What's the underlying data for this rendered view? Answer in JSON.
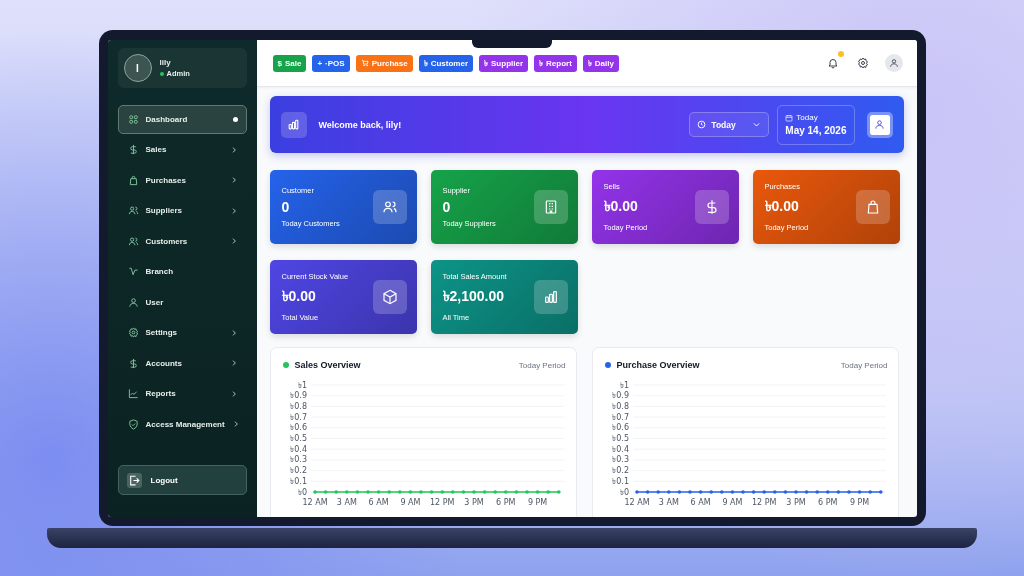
{
  "sidebar": {
    "user": {
      "initial": "I",
      "name": "lily",
      "role": "Admin",
      "online": true
    },
    "items": [
      {
        "label": "Dashboard",
        "selected": true,
        "has_submenu": false
      },
      {
        "label": "Sales",
        "selected": false,
        "has_submenu": true
      },
      {
        "label": "Purchases",
        "selected": false,
        "has_submenu": true
      },
      {
        "label": "Suppliers",
        "selected": false,
        "has_submenu": true
      },
      {
        "label": "Customers",
        "selected": false,
        "has_submenu": true
      },
      {
        "label": "Branch",
        "selected": false,
        "has_submenu": false
      },
      {
        "label": "User",
        "selected": false,
        "has_submenu": false
      },
      {
        "label": "Settings",
        "selected": false,
        "has_submenu": true
      },
      {
        "label": "Accounts",
        "selected": false,
        "has_submenu": true
      },
      {
        "label": "Reports",
        "selected": false,
        "has_submenu": true
      },
      {
        "label": "Access Management",
        "selected": false,
        "has_submenu": true
      }
    ],
    "logout": "Logout"
  },
  "quick_actions": [
    {
      "icon": "$",
      "label": "Sale",
      "color": "#16a34a"
    },
    {
      "icon": "+",
      "label": "·POS",
      "color": "#2563eb"
    },
    {
      "label": "Purchase",
      "color": "#f97316"
    },
    {
      "icon": "৳",
      "label": "Customer",
      "color": "#2563eb"
    },
    {
      "icon": "৳",
      "label": "Supplier",
      "color": "#9333ea"
    },
    {
      "icon": "৳",
      "label": "Report",
      "color": "#9333ea"
    },
    {
      "icon": "৳",
      "label": "Daily",
      "color": "#9333ea"
    }
  ],
  "header": {
    "notifications": true
  },
  "banner": {
    "greeting": "Welcome back, lily!",
    "period": "Today",
    "date_label": "Today",
    "date": "May 14, 2026"
  },
  "stats": [
    {
      "title": "Customer",
      "value": "0",
      "caption": "Today Customers",
      "color": "#2563eb"
    },
    {
      "title": "Supplier",
      "value": "0",
      "caption": "Today Suppliers",
      "color": "#16a34a"
    },
    {
      "title": "Sells",
      "value": "৳0.00",
      "caption": "Today Period",
      "color": "#9333ea"
    },
    {
      "title": "Purchases",
      "value": "৳0.00",
      "caption": "Today Period",
      "color": "#ea580c"
    },
    {
      "title": "Current Stock Value",
      "value": "৳0.00",
      "caption": "Total Value",
      "color": "#4f46e5"
    },
    {
      "title": "Total Sales Amount",
      "value": "৳2,100.00",
      "caption": "All Time",
      "color": "#0d9488"
    }
  ],
  "charts": [
    {
      "title": "Sales Overview",
      "period": "Today Period",
      "chart_data": {
        "type": "line",
        "grid": true,
        "categories": [
          "12 AM",
          null,
          null,
          "3 AM",
          null,
          null,
          "6 AM",
          null,
          null,
          "9 AM",
          null,
          null,
          "12 PM",
          null,
          null,
          "3 PM",
          null,
          null,
          "6 PM",
          null,
          null,
          "9 PM",
          null,
          null
        ],
        "ylim": [
          0,
          1
        ],
        "yticks": [
          {
            "value": 0,
            "label": "৳0"
          },
          {
            "value": 0.1,
            "label": "৳0.1"
          },
          {
            "value": 0.2,
            "label": "৳0.2"
          },
          {
            "value": 0.3,
            "label": "৳0.3"
          },
          {
            "value": 0.4,
            "label": "৳0.4"
          },
          {
            "value": 0.5,
            "label": "৳0.5"
          },
          {
            "value": 0.6,
            "label": "৳0.6"
          },
          {
            "value": 0.7,
            "label": "৳0.7"
          },
          {
            "value": 0.8,
            "label": "৳0.8"
          },
          {
            "value": 0.9,
            "label": "৳0.9"
          },
          {
            "value": 1,
            "label": "৳1"
          }
        ],
        "series": [
          {
            "color": "#22c55e",
            "values": [
              0,
              0,
              0,
              0,
              0,
              0,
              0,
              0,
              0,
              0,
              0,
              0,
              0,
              0,
              0,
              0,
              0,
              0,
              0,
              0,
              0,
              0,
              0,
              0
            ]
          }
        ]
      }
    },
    {
      "title": "Purchase Overview",
      "period": "Today Period",
      "chart_data": {
        "type": "line",
        "grid": true,
        "categories": [
          "12 AM",
          null,
          null,
          "3 AM",
          null,
          null,
          "6 AM",
          null,
          null,
          "9 AM",
          null,
          null,
          "12 PM",
          null,
          null,
          "3 PM",
          null,
          null,
          "6 PM",
          null,
          null,
          "9 PM",
          null,
          null
        ],
        "ylim": [
          0,
          1
        ],
        "yticks": [
          {
            "value": 0,
            "label": "৳0"
          },
          {
            "value": 0.1,
            "label": "৳0.1"
          },
          {
            "value": 0.2,
            "label": "৳0.2"
          },
          {
            "value": 0.3,
            "label": "৳0.3"
          },
          {
            "value": 0.4,
            "label": "৳0.4"
          },
          {
            "value": 0.5,
            "label": "৳0.5"
          },
          {
            "value": 0.6,
            "label": "৳0.6"
          },
          {
            "value": 0.7,
            "label": "৳0.7"
          },
          {
            "value": 0.8,
            "label": "৳0.8"
          },
          {
            "value": 0.9,
            "label": "৳0.9"
          },
          {
            "value": 1,
            "label": "৳1"
          }
        ],
        "series": [
          {
            "color": "#2563eb",
            "values": [
              0,
              0,
              0,
              0,
              0,
              0,
              0,
              0,
              0,
              0,
              0,
              0,
              0,
              0,
              0,
              0,
              0,
              0,
              0,
              0,
              0,
              0,
              0,
              0
            ]
          }
        ]
      }
    }
  ]
}
